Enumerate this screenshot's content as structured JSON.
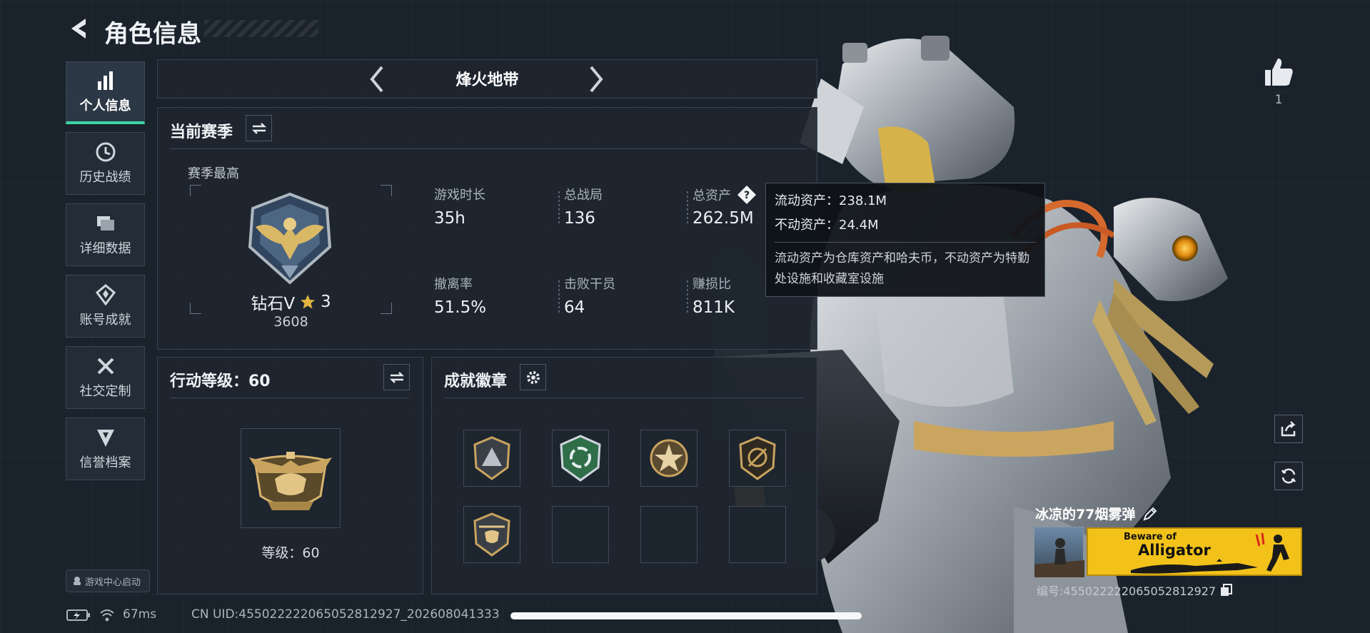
{
  "header": {
    "title": "角色信息"
  },
  "sidebar": {
    "items": [
      {
        "label": "个人信息",
        "icon": "bar-chart-icon",
        "active": true
      },
      {
        "label": "历史战绩",
        "icon": "clock-icon"
      },
      {
        "label": "详细数据",
        "icon": "stack-icon"
      },
      {
        "label": "账号成就",
        "icon": "achievement-icon"
      },
      {
        "label": "社交定制",
        "icon": "tools-icon"
      },
      {
        "label": "信誉档案",
        "icon": "shield-badge-icon"
      }
    ],
    "game_center": "游戏中心启动"
  },
  "mode": {
    "title": "烽火地带"
  },
  "season": {
    "title": "当前赛季",
    "best_label": "赛季最高",
    "rank_name": "钻石V",
    "rank_stars": "3",
    "rank_score": "3608",
    "stats": [
      {
        "label": "游戏时长",
        "value": "35h"
      },
      {
        "label": "总战局",
        "value": "136"
      },
      {
        "label": "总资产",
        "value": "262.5M"
      },
      {
        "label": "撤离率",
        "value": "51.5%"
      },
      {
        "label": "击败干员",
        "value": "64"
      },
      {
        "label": "赚损比",
        "value": "811K"
      }
    ]
  },
  "tooltip": {
    "line1": "流动资产：238.1M",
    "line2": "不动资产：24.4M",
    "desc": "流动资产为仓库资产和哈夫币，不动资产为特勤处设施和收藏室设施"
  },
  "action_level": {
    "title": "行动等级：60",
    "level_text": "等级：60"
  },
  "badges": {
    "title": "成就徽章"
  },
  "right": {
    "likes": "1"
  },
  "player": {
    "name": "冰凉的77烟雾弹",
    "banner_line1": "Beware of",
    "banner_line2": "Alligator",
    "uid_label": "编号:455022222065052812927"
  },
  "status": {
    "ping": "67ms",
    "uid": "CN UID:455022222065052812927_202608041333"
  },
  "colors": {
    "accent": "#3ad6a2",
    "banner": "#f2c21a",
    "star": "#e2b53f"
  }
}
